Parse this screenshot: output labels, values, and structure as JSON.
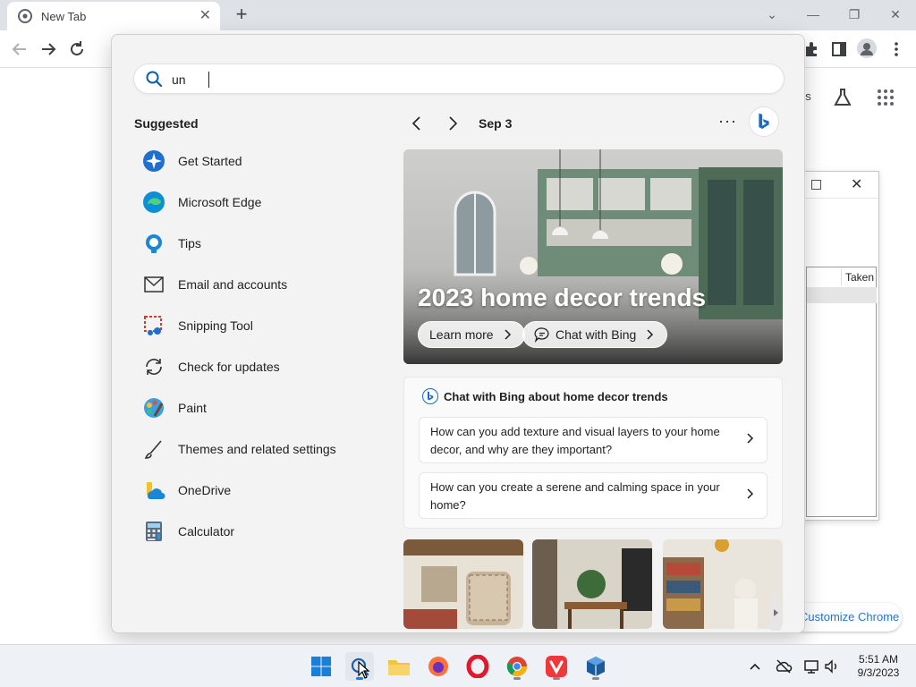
{
  "browser": {
    "tab": {
      "title": "New Tab"
    },
    "new_tab_symbol": "+",
    "ntp": {
      "customize_label": "Customize Chrome",
      "partial_text": "es"
    }
  },
  "background_window": {
    "column_header": "Taken"
  },
  "search": {
    "query": "un",
    "suggested_heading": "Suggested",
    "suggestions": [
      {
        "label": "Get Started",
        "icon": "get-started-icon"
      },
      {
        "label": "Microsoft Edge",
        "icon": "edge-icon"
      },
      {
        "label": "Tips",
        "icon": "tips-icon"
      },
      {
        "label": "Email and accounts",
        "icon": "mail-icon"
      },
      {
        "label": "Snipping Tool",
        "icon": "snipping-tool-icon"
      },
      {
        "label": "Check for updates",
        "icon": "refresh-icon"
      },
      {
        "label": "Paint",
        "icon": "paint-icon"
      },
      {
        "label": "Themes and related settings",
        "icon": "brush-icon"
      },
      {
        "label": "OneDrive",
        "icon": "onedrive-icon"
      },
      {
        "label": "Calculator",
        "icon": "calculator-icon"
      }
    ],
    "date": "Sep 3",
    "more_symbol": "···",
    "hero": {
      "title": "2023 home decor trends",
      "learn_more": "Learn more",
      "chat_with_bing": "Chat with Bing"
    },
    "chat_card": {
      "title": "Chat with Bing about home decor trends",
      "questions": [
        "How can you add texture and visual layers to your home decor, and why are they important?",
        "How can you create a serene and calming space in your home?"
      ]
    }
  },
  "taskbar": {
    "time": "5:51 AM",
    "date": "9/3/2023"
  },
  "colors": {
    "accent": "#1a73e8",
    "panel_bg": "#f3f3f3",
    "taskbar_bg": "#eef2f6"
  }
}
